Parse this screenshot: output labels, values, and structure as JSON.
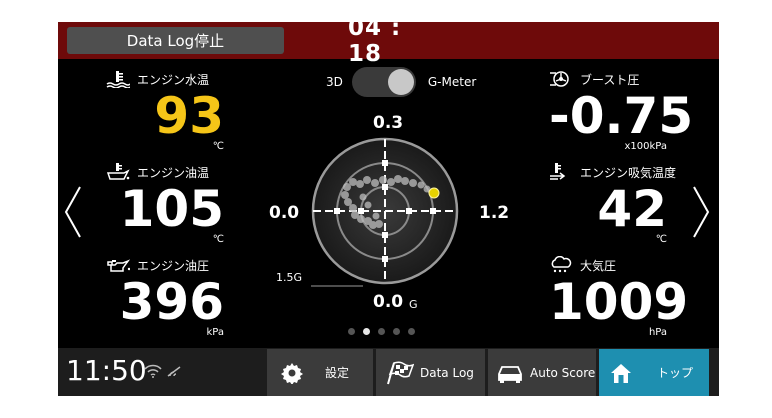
{
  "topbar": {
    "datalog_stop_label": "Data Log停止",
    "timer": "04 : 18",
    "background_color": "#6e0a0a"
  },
  "gauges": {
    "water_temp": {
      "label": "エンジン水温",
      "value": "93",
      "unit": "℃",
      "icon": "coolant-temp-icon",
      "value_color": "#f5c518"
    },
    "oil_temp": {
      "label": "エンジン油温",
      "value": "105",
      "unit": "℃",
      "icon": "oil-temp-icon"
    },
    "oil_pressure": {
      "label": "エンジン油圧",
      "value": "396",
      "unit": "kPa",
      "icon": "oil-can-icon"
    },
    "boost": {
      "label": "ブースト圧",
      "value": "-0.75",
      "unit": "x100kPa",
      "icon": "turbo-icon"
    },
    "intake_temp": {
      "label": "エンジン吸気温度",
      "value": "42",
      "unit": "℃",
      "icon": "intake-temp-icon"
    },
    "atmospheric": {
      "label": "大気圧",
      "value": "1009",
      "unit": "hPa",
      "icon": "weather-icon"
    }
  },
  "toggle": {
    "left_label": "3D",
    "right_label": "G-Meter",
    "state": "G-Meter"
  },
  "gmeter": {
    "top_label": "0.3",
    "left_label": "0.0",
    "right_label": "1.2",
    "bottom_label": "0.0",
    "bottom_unit": "G",
    "scale_label": "1.5G"
  },
  "pager": {
    "pages": 5,
    "active": 1
  },
  "bottombar": {
    "clock": "11:50",
    "buttons": {
      "settings": "設定",
      "datalog": "Data Log",
      "autoscore": "Auto Score",
      "top": "トップ"
    },
    "active_color": "#1e8fb0"
  }
}
